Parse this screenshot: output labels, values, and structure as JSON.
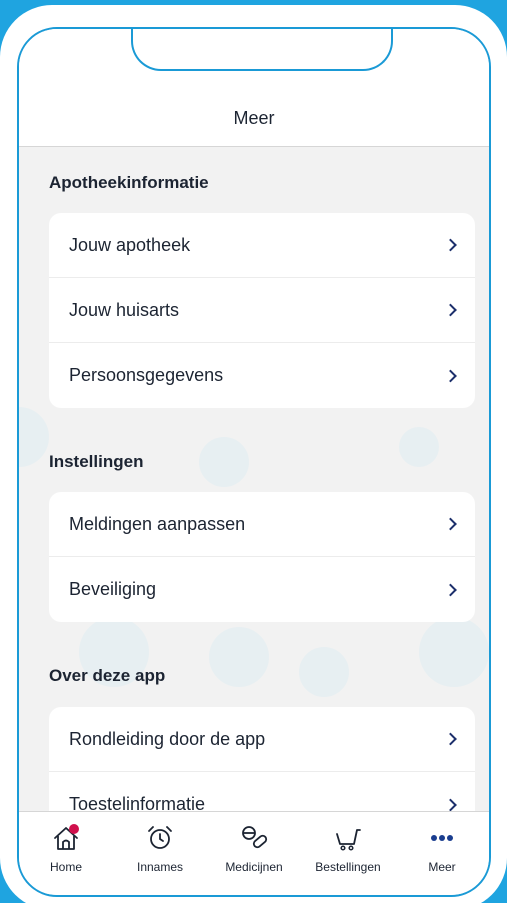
{
  "header": {
    "title": "Meer"
  },
  "sections": [
    {
      "title": "Apotheekinformatie",
      "items": [
        {
          "label": "Jouw apotheek"
        },
        {
          "label": "Jouw huisarts"
        },
        {
          "label": "Persoonsgegevens"
        }
      ]
    },
    {
      "title": "Instellingen",
      "items": [
        {
          "label": "Meldingen aanpassen"
        },
        {
          "label": "Beveiliging"
        }
      ]
    },
    {
      "title": "Over deze app",
      "items": [
        {
          "label": "Rondleiding door de app"
        },
        {
          "label": "Toestelinformatie"
        }
      ]
    }
  ],
  "tabbar": {
    "items": [
      {
        "label": "Home",
        "icon": "home-icon"
      },
      {
        "label": "Innames",
        "icon": "alarm-clock-icon"
      },
      {
        "label": "Medicijnen",
        "icon": "pills-icon"
      },
      {
        "label": "Bestellingen",
        "icon": "cart-icon"
      },
      {
        "label": "Meer",
        "icon": "more-dots-icon"
      }
    ],
    "active": "Meer"
  },
  "colors": {
    "background": "#1fa4e0",
    "frame_border": "#1a9ad6",
    "text": "#1c2432",
    "chevron": "#1c2f6b",
    "notification_dot": "#d0104c",
    "more_dots": "#1a3d8f"
  }
}
